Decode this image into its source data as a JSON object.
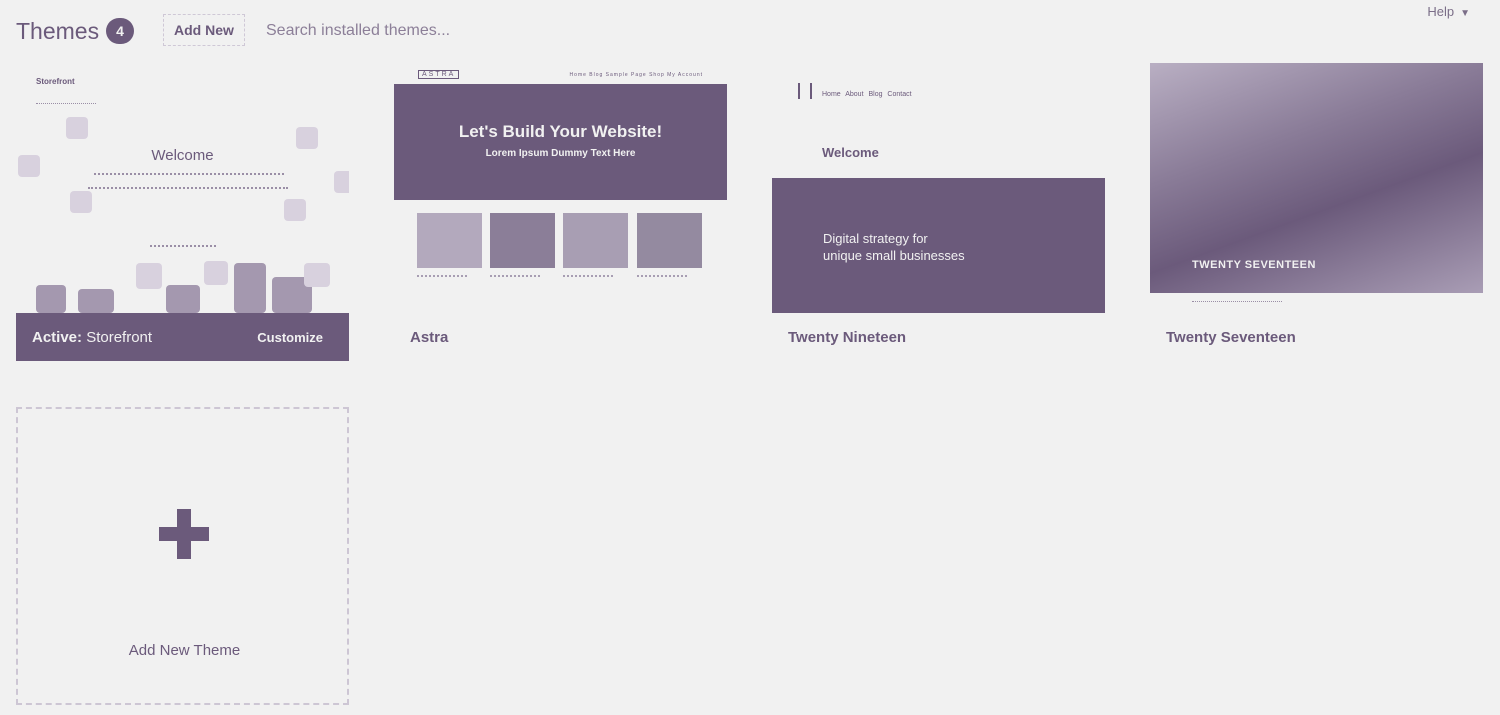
{
  "header": {
    "title": "Themes",
    "count": "4",
    "add_new_label": "Add New",
    "search_placeholder": "Search installed themes...",
    "help_label": "Help"
  },
  "themes": [
    {
      "name": "Storefront",
      "active": true,
      "active_prefix": "Active:",
      "customize_label": "Customize",
      "preview": {
        "logo": "Storefront",
        "heading": "Welcome"
      }
    },
    {
      "name": "Astra",
      "preview": {
        "logo": "ASTRA",
        "menu": "Home  Blog  Sample Page  Shop  My Account",
        "hero_title": "Let's Build Your Website!",
        "hero_subtitle": "Lorem Ipsum Dummy Text Here"
      }
    },
    {
      "name": "Twenty Nineteen",
      "preview": {
        "nav": "Home About Blog Contact",
        "heading": "Welcome",
        "hero_line1": "Digital strategy for",
        "hero_line2": "unique small businesses"
      }
    },
    {
      "name": "Twenty Seventeen",
      "preview": {
        "hero_title": "TWENTY SEVENTEEN"
      }
    }
  ],
  "add_theme": {
    "label": "Add New Theme"
  },
  "colors": {
    "accent": "#6b5a7b",
    "background": "#f1f1f1"
  }
}
